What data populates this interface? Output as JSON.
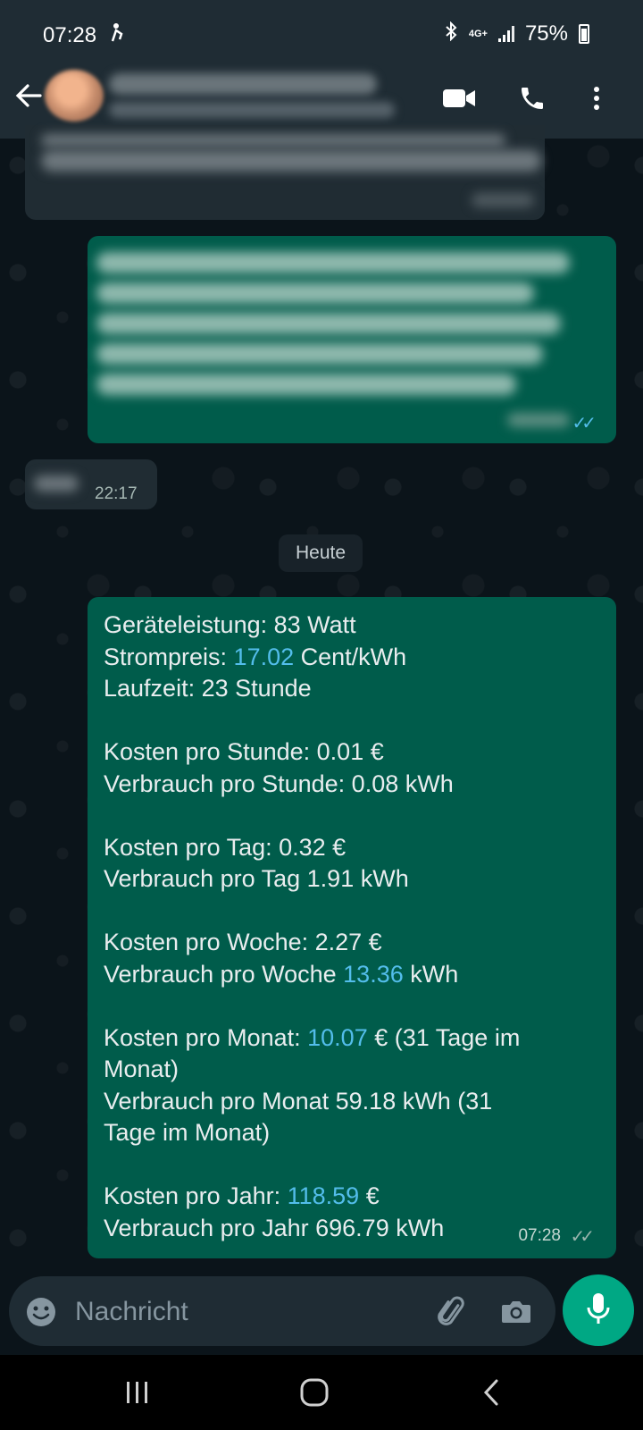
{
  "status": {
    "time": "07:28",
    "network": "4G+",
    "battery": "75%",
    "battery_level": 0.75
  },
  "dates": {
    "separator": "Heute"
  },
  "messages": {
    "incoming_time": "22:17",
    "main_time": "07:28",
    "main_lines": {
      "l1": "Geräteleistung: 83 Watt",
      "l2_pre": "Strompreis: ",
      "l2_hl": "17.02",
      "l2_post": " Cent/kWh",
      "l3": "Laufzeit: 23 Stunde",
      "l4": "Kosten pro Stunde: 0.01 €",
      "l5": "Verbrauch pro Stunde: 0.08 kWh",
      "l6": "Kosten pro Tag: 0.32 €",
      "l7": "Verbrauch pro Tag 1.91 kWh",
      "l8": "Kosten pro Woche: 2.27 €",
      "l9_pre": "Verbrauch pro Woche ",
      "l9_hl": "13.36",
      "l9_post": " kWh",
      "l10_pre": "Kosten pro Monat: ",
      "l10_hl": "10.07",
      "l10_post": " € (31 Tage im",
      "l11": "Monat)",
      "l12": "Verbrauch pro Monat 59.18 kWh (31",
      "l13": "Tage im Monat)",
      "l14_pre": "Kosten pro Jahr: ",
      "l14_hl": "118.59",
      "l14_post": " €",
      "l15": "Verbrauch pro Jahr 696.79 kWh"
    }
  },
  "input": {
    "placeholder": "Nachricht"
  },
  "icons": {
    "back": "arrow-left-icon",
    "video": "video-camera-icon",
    "call": "phone-icon",
    "menu": "more-vertical-icon",
    "emoji": "emoji-icon",
    "attach": "paperclip-icon",
    "camera": "camera-icon",
    "mic": "microphone-icon"
  },
  "colors": {
    "outgoing_bubble": "#005c4b",
    "incoming_bubble": "#202c33",
    "accent": "#00a884",
    "link": "#53bdeb"
  }
}
